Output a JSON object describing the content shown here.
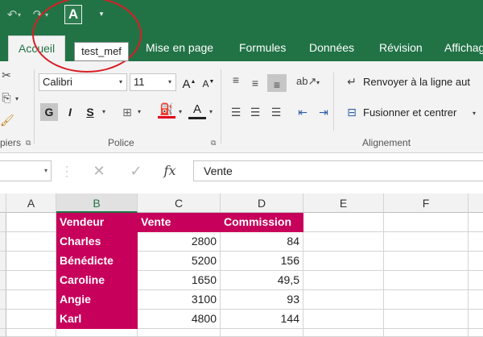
{
  "quick_access": {
    "undo_icon": "undo-icon",
    "redo_icon": "redo-icon",
    "format_icon_letter": "A",
    "tooltip": "test_mef"
  },
  "tabs": [
    {
      "label": "Accueil",
      "active": true
    },
    {
      "label": "Mise en page"
    },
    {
      "label": "Formules"
    },
    {
      "label": "Données"
    },
    {
      "label": "Révision"
    },
    {
      "label": "Affichag"
    }
  ],
  "ribbon": {
    "clipboard_label": "piers",
    "font": {
      "name": "Calibri",
      "size": "11",
      "grow": "A",
      "shrink": "A",
      "bold": "G",
      "italic": "I",
      "underline": "S",
      "font_color_letter": "A",
      "group_label": "Police"
    },
    "alignment": {
      "wrap_text": "Renvoyer à la ligne aut",
      "merge_center": "Fusionner et centrer",
      "group_label": "Alignement"
    }
  },
  "formula_bar": {
    "name_box": "",
    "cancel": "✕",
    "confirm": "✓",
    "fx": "fx",
    "value": "Vente"
  },
  "columns": [
    "A",
    "B",
    "C",
    "D",
    "E",
    "F"
  ],
  "selected_column": "B",
  "table": {
    "headers": [
      "Vendeur",
      "Vente",
      "Commission"
    ],
    "rows": [
      [
        "Charles",
        "2800",
        "84"
      ],
      [
        "Bénédicte",
        "5200",
        "156"
      ],
      [
        "Caroline",
        "1650",
        "49,5"
      ],
      [
        "Angie",
        "3100",
        "93"
      ],
      [
        "Karl",
        "4800",
        "144"
      ]
    ]
  },
  "colors": {
    "excel_green": "#217346",
    "table_magenta": "#c7005b",
    "annotation_red": "#d81f26"
  }
}
